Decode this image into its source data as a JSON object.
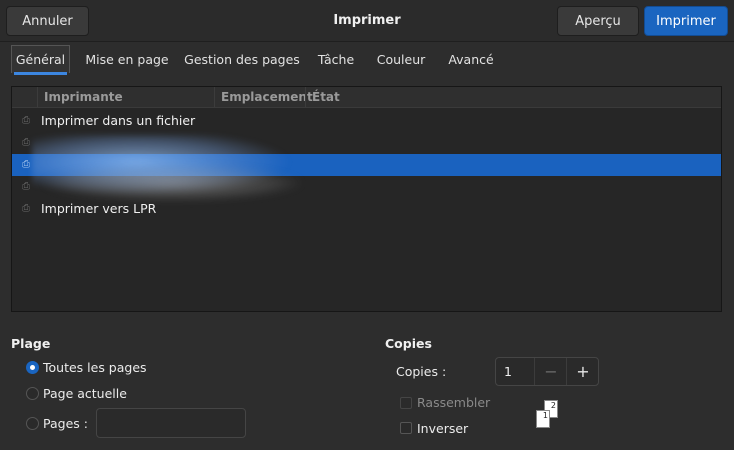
{
  "header": {
    "title": "Imprimer",
    "cancel_label": "Annuler",
    "preview_label": "Aperçu",
    "print_label": "Imprimer"
  },
  "tabs": [
    {
      "label": "Général",
      "active": true
    },
    {
      "label": "Mise en page",
      "active": false
    },
    {
      "label": "Gestion des pages",
      "active": false
    },
    {
      "label": "Tâche",
      "active": false
    },
    {
      "label": "Couleur",
      "active": false
    },
    {
      "label": "Avancé",
      "active": false
    }
  ],
  "printer_list": {
    "columns": [
      "Imprimante",
      "Emplacement",
      "État"
    ],
    "rows": [
      {
        "name": "Imprimer dans un fichier",
        "selected": false
      },
      {
        "name": "",
        "selected": false
      },
      {
        "name": "",
        "selected": true
      },
      {
        "name": "",
        "selected": false
      },
      {
        "name": "Imprimer vers LPR",
        "selected": false
      }
    ]
  },
  "range": {
    "title": "Plage",
    "options": [
      {
        "label": "Toutes les pages",
        "checked": true
      },
      {
        "label": "Page actuelle",
        "checked": false
      },
      {
        "label": "Pages :",
        "checked": false
      }
    ],
    "pages_value": ""
  },
  "copies": {
    "title": "Copies",
    "label": "Copies :",
    "value": "1",
    "minus": "−",
    "plus": "+",
    "collate_label": "Rassembler",
    "reverse_label": "Inverser",
    "page_number_1": "1",
    "page_number_2": "2"
  },
  "colors": {
    "accent": "#1a65c0",
    "background": "#2d2d2d"
  }
}
